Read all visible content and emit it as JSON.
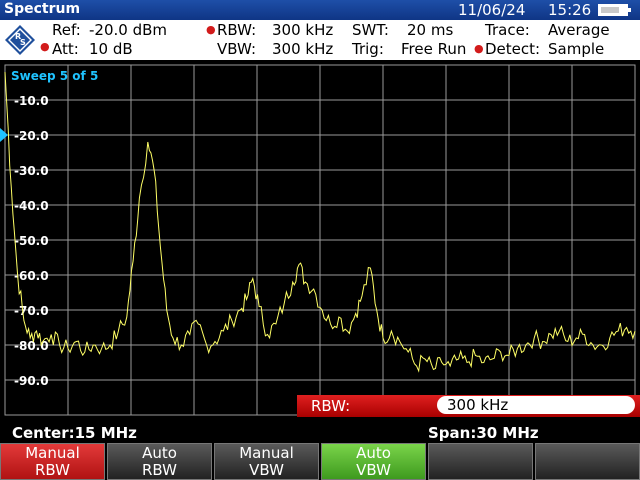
{
  "titlebar": {
    "app_name": "Spectrum",
    "date": "11/06/24",
    "time": "15:26"
  },
  "params": {
    "ref_label": "Ref:",
    "ref_value": "-20.0 dBm",
    "att_label": "Att:",
    "att_value": "10 dB",
    "rbw_label": "RBW:",
    "rbw_value": "300 kHz",
    "vbw_label": "VBW:",
    "vbw_value": "300 kHz",
    "swt_label": "SWT:",
    "swt_value": "20 ms",
    "trig_label": "Trig:",
    "trig_value": "Free Run",
    "trace_label": "Trace:",
    "trace_value": "Average",
    "detect_label": "Detect:",
    "detect_value": "Sample",
    "bullet": "●"
  },
  "graph": {
    "sweep_label": "Sweep 5 of 5",
    "y_labels": [
      "-10.0",
      "-20.0",
      "-30.0",
      "-40.0",
      "-50.0",
      "-60.0",
      "-70.0",
      "-80.0",
      "-90.0"
    ],
    "colors": {
      "trace": "#ffff66",
      "grid": "#9a9a9a",
      "marker": "#1fc3ff",
      "background": "#000000"
    },
    "chart_data": {
      "type": "line",
      "x_unit": "MHz",
      "y_unit": "dBm",
      "xlim": [
        0,
        30
      ],
      "ylim": [
        -100,
        0
      ],
      "reference_level_dbm": -20.0,
      "peaks": [
        {
          "freq_mhz": 6.8,
          "level_dbm": -22
        },
        {
          "freq_mhz": 11.8,
          "level_dbm": -61
        },
        {
          "freq_mhz": 14.0,
          "level_dbm": -57
        },
        {
          "freq_mhz": 17.4,
          "level_dbm": -58
        }
      ],
      "trace_points": [
        [
          0.0,
          -2
        ],
        [
          0.3,
          -35
        ],
        [
          0.6,
          -60
        ],
        [
          0.9,
          -73
        ],
        [
          1.2,
          -78
        ],
        [
          1.5,
          -76
        ],
        [
          1.8,
          -79
        ],
        [
          2.2,
          -77
        ],
        [
          2.6,
          -80
        ],
        [
          3.0,
          -81
        ],
        [
          3.4,
          -79
        ],
        [
          3.8,
          -82
        ],
        [
          4.2,
          -80
        ],
        [
          4.6,
          -81
        ],
        [
          5.0,
          -80
        ],
        [
          5.4,
          -76
        ],
        [
          5.8,
          -72
        ],
        [
          6.1,
          -56
        ],
        [
          6.4,
          -38
        ],
        [
          6.8,
          -22
        ],
        [
          7.1,
          -30
        ],
        [
          7.4,
          -52
        ],
        [
          7.7,
          -70
        ],
        [
          8.0,
          -78
        ],
        [
          8.4,
          -80
        ],
        [
          8.8,
          -77
        ],
        [
          9.2,
          -74
        ],
        [
          9.6,
          -80
        ],
        [
          10.0,
          -79
        ],
        [
          10.4,
          -76
        ],
        [
          10.8,
          -73
        ],
        [
          11.2,
          -70
        ],
        [
          11.5,
          -67
        ],
        [
          11.8,
          -61
        ],
        [
          12.1,
          -69
        ],
        [
          12.5,
          -77
        ],
        [
          12.9,
          -74
        ],
        [
          13.3,
          -68
        ],
        [
          13.7,
          -62
        ],
        [
          14.0,
          -57
        ],
        [
          14.3,
          -62
        ],
        [
          14.7,
          -64
        ],
        [
          15.1,
          -70
        ],
        [
          15.5,
          -74
        ],
        [
          15.9,
          -72
        ],
        [
          16.3,
          -76
        ],
        [
          16.7,
          -71
        ],
        [
          17.0,
          -66
        ],
        [
          17.4,
          -58
        ],
        [
          17.7,
          -70
        ],
        [
          18.0,
          -78
        ],
        [
          18.4,
          -76
        ],
        [
          18.8,
          -79
        ],
        [
          19.2,
          -82
        ],
        [
          19.6,
          -86
        ],
        [
          20.0,
          -84
        ],
        [
          20.4,
          -87
        ],
        [
          20.8,
          -85
        ],
        [
          21.2,
          -86
        ],
        [
          21.6,
          -84
        ],
        [
          22.0,
          -85
        ],
        [
          22.4,
          -83
        ],
        [
          22.8,
          -85
        ],
        [
          23.2,
          -84
        ],
        [
          23.6,
          -82
        ],
        [
          24.0,
          -83
        ],
        [
          24.4,
          -81
        ],
        [
          24.8,
          -80
        ],
        [
          25.2,
          -78
        ],
        [
          25.6,
          -79
        ],
        [
          26.0,
          -77
        ],
        [
          26.4,
          -76
        ],
        [
          26.8,
          -79
        ],
        [
          27.2,
          -78
        ],
        [
          27.6,
          -77
        ],
        [
          28.0,
          -80
        ],
        [
          28.4,
          -80
        ],
        [
          28.8,
          -78
        ],
        [
          29.2,
          -76
        ],
        [
          29.6,
          -75
        ],
        [
          30.0,
          -76
        ]
      ]
    }
  },
  "rbw_entry": {
    "label": "RBW:",
    "value": "300 kHz"
  },
  "bottom": {
    "center": "Center:15 MHz",
    "span": "Span:30 MHz"
  },
  "softkeys": [
    {
      "top": "Manual",
      "bottom": "RBW",
      "state": "active-red"
    },
    {
      "top": "Auto",
      "bottom": "RBW",
      "state": "normal"
    },
    {
      "top": "Manual",
      "bottom": "VBW",
      "state": "normal"
    },
    {
      "top": "Auto",
      "bottom": "VBW",
      "state": "active-green"
    },
    {
      "top": "",
      "bottom": "",
      "state": "empty"
    },
    {
      "top": "",
      "bottom": "",
      "state": "empty"
    }
  ]
}
